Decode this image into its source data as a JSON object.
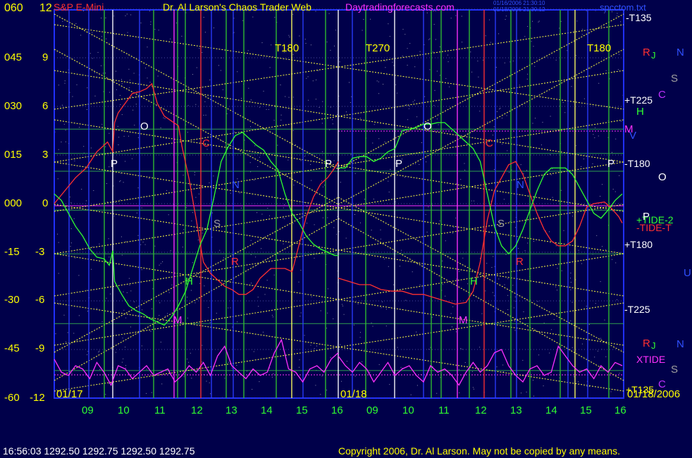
{
  "header": {
    "symbol": "S&P E-Mini",
    "author": "Dr. Al Larson's Chaos Trader Web",
    "website": "Daytradingforecasts.com",
    "info_1": "01/16/2006 21:30:10",
    "info_2": "01/18/2006 21:30:12",
    "file": "spcctom.txt"
  },
  "left_axis": {
    "outer": [
      "060",
      "045",
      "030",
      "015",
      "000",
      "-15",
      "-30",
      "-45",
      "-60"
    ],
    "inner": [
      "12",
      "9",
      "6",
      "3",
      "0",
      "-3",
      "-6",
      "-9",
      "-12"
    ]
  },
  "dates": {
    "day1": "01/17",
    "day2": "01/18",
    "end": "01/18/2006"
  },
  "x_axis": {
    "day1": [
      "09",
      "10",
      "11",
      "12",
      "13",
      "14",
      "15",
      "16"
    ],
    "day2": [
      "09",
      "10",
      "11",
      "12",
      "13",
      "14",
      "15",
      "16"
    ]
  },
  "right_labels": {
    "t135_top": "-T135",
    "t225_plus": "+T225",
    "t180_minus": "-T180",
    "t180_plus": "+T180",
    "t225_minus": "-T225",
    "t135_bottom": "+T135",
    "tide2": "+TIDE-2",
    "tidet": "-TIDE-T",
    "xtide": "XTIDE"
  },
  "markers": {
    "t180_a": "T180",
    "t270": "T270",
    "t180_b": "T180"
  },
  "planet_letters": [
    "O",
    "P",
    "N",
    "S",
    "R",
    "J",
    "H",
    "M",
    "C",
    "V",
    "U"
  ],
  "footer": {
    "quote": "16:56:03  1292.50  1292.75  1292.50  1292.75",
    "copyright": "Copyright 2006, Dr. Al Larson. May not be copied by any means."
  },
  "colors": {
    "background": "#00004a",
    "price": "#ff3030",
    "tide": "#30ff30",
    "xtide": "#ff30ff",
    "axis_text": "#ffff00",
    "hour_text": "#30ff30",
    "grid_dots": "#ffffff"
  },
  "chart_data": {
    "type": "line",
    "ylim_outer": [
      -60,
      60
    ],
    "ylim_inner": [
      -12,
      12
    ],
    "xlim": [
      8.0,
      16.0
    ],
    "series": [
      {
        "name": "TIDE-T",
        "color": "#ff3030",
        "day1": {
          "x": [
            8.0,
            8.3,
            8.6,
            8.9,
            9.2,
            9.5,
            9.65,
            9.7,
            9.8,
            10.0,
            10.2,
            10.4,
            10.6,
            10.75,
            10.9,
            11.1,
            11.3,
            11.5,
            11.6,
            11.8,
            12.0,
            12.2,
            12.4,
            12.6,
            12.8,
            13.0,
            13.2,
            13.4,
            13.6,
            13.8,
            14.0,
            14.1,
            14.3,
            14.5,
            14.7,
            14.9,
            15.1,
            15.3,
            15.5,
            15.7,
            15.9,
            16.0
          ],
          "y": [
            0.0,
            0.8,
            1.6,
            2.2,
            3.2,
            3.8,
            3.2,
            5.0,
            5.6,
            6.2,
            6.8,
            6.9,
            7.1,
            7.4,
            6.2,
            5.4,
            5.1,
            4.8,
            3.5,
            1.5,
            -1.0,
            -3.6,
            -4.3,
            -4.7,
            -5.1,
            -5.3,
            -5.6,
            -5.6,
            -5.3,
            -4.6,
            -4.2,
            -4.0,
            -4.0,
            -4.0,
            -4.2,
            -2.5,
            -0.8,
            0.4,
            1.2,
            1.6,
            2.2,
            2.6
          ]
        },
        "day2": {
          "x": [
            8.0,
            8.3,
            8.6,
            8.9,
            9.2,
            9.5,
            9.8,
            10.1,
            10.4,
            10.7,
            11.0,
            11.3,
            11.6,
            11.8,
            12.0,
            12.2,
            12.4,
            12.6,
            12.8,
            13.0,
            13.2,
            13.4,
            13.6,
            13.8,
            14.0,
            14.2,
            14.4,
            14.6,
            14.8,
            15.0,
            15.2,
            15.5,
            15.7,
            15.9,
            16.0
          ],
          "y": [
            -4.6,
            -4.8,
            -5.0,
            -5.0,
            -5.3,
            -5.4,
            -5.4,
            -5.6,
            -5.6,
            -5.8,
            -6.0,
            -6.2,
            -6.1,
            -5.4,
            -3.6,
            -1.0,
            0.8,
            1.6,
            2.4,
            2.6,
            1.8,
            0.6,
            -0.6,
            -1.6,
            -2.3,
            -2.6,
            -2.6,
            -2.3,
            -1.4,
            -0.2,
            0.0,
            0.1,
            -0.3,
            -0.8,
            -1.2
          ]
        }
      },
      {
        "name": "TIDE-2",
        "color": "#30ff30",
        "day1": {
          "x": [
            8.0,
            8.2,
            8.4,
            8.6,
            8.8,
            9.0,
            9.2,
            9.4,
            9.55,
            9.65,
            9.7,
            9.9,
            10.1,
            10.3,
            10.5,
            10.7,
            10.9,
            11.1,
            11.3,
            11.5,
            11.7,
            11.9,
            12.1,
            12.3,
            12.5,
            12.7,
            12.9,
            13.1,
            13.3,
            13.5,
            13.7,
            13.9,
            14.1,
            14.3,
            14.5,
            14.7,
            14.9,
            15.1,
            15.3,
            15.5,
            15.7,
            15.9,
            16.0
          ],
          "y": [
            0.6,
            0.2,
            -0.6,
            -1.4,
            -2.0,
            -2.8,
            -3.3,
            -3.4,
            -3.8,
            -2.9,
            -4.8,
            -5.6,
            -6.3,
            -6.6,
            -6.8,
            -7.1,
            -7.3,
            -7.5,
            -7.0,
            -6.3,
            -5.4,
            -4.0,
            -2.6,
            -1.6,
            0.4,
            2.6,
            3.5,
            4.2,
            4.4,
            4.0,
            3.6,
            3.3,
            2.6,
            2.1,
            0.6,
            -0.6,
            -1.2,
            -2.0,
            -2.5,
            -2.8,
            -3.0,
            -3.2,
            -3.2
          ]
        },
        "day2": {
          "x": [
            8.0,
            8.2,
            8.4,
            8.6,
            8.8,
            9.0,
            9.2,
            9.4,
            9.6,
            9.8,
            10.0,
            10.2,
            10.4,
            10.6,
            10.8,
            11.0,
            11.2,
            11.4,
            11.6,
            11.8,
            12.0,
            12.2,
            12.4,
            12.6,
            12.8,
            13.0,
            13.2,
            13.4,
            13.6,
            13.8,
            14.0,
            14.2,
            14.4,
            14.6,
            14.8,
            15.0,
            15.2,
            15.4,
            15.6,
            15.8,
            16.0
          ],
          "y": [
            2.2,
            2.2,
            2.8,
            2.9,
            2.9,
            2.6,
            2.8,
            3.2,
            3.4,
            4.5,
            4.6,
            4.7,
            4.9,
            4.9,
            5.0,
            5.0,
            4.6,
            4.2,
            3.8,
            3.4,
            2.6,
            0.6,
            -1.4,
            -2.6,
            -3.1,
            -2.6,
            -1.6,
            -0.4,
            0.8,
            1.8,
            2.2,
            2.2,
            2.2,
            1.8,
            1.0,
            0.2,
            -0.6,
            -0.9,
            -0.4,
            0.2,
            0.6
          ]
        }
      },
      {
        "name": "XTIDE",
        "color": "#ff30ff",
        "day1": {
          "x": [
            8.0,
            8.2,
            8.4,
            8.6,
            8.8,
            9.0,
            9.2,
            9.4,
            9.6,
            9.8,
            10.0,
            10.2,
            10.4,
            10.6,
            10.8,
            11.0,
            11.2,
            11.4,
            11.6,
            11.8,
            12.0,
            12.2,
            12.4,
            12.6,
            12.8,
            13.0,
            13.2,
            13.4,
            13.6,
            13.8,
            14.0,
            14.2,
            14.4,
            14.6,
            14.8,
            15.0,
            15.2,
            15.4,
            15.6,
            15.8,
            16.0
          ],
          "y": [
            -48,
            -52,
            -53,
            -50,
            -51,
            -54,
            -49,
            -52,
            -56,
            -50,
            -51,
            -54,
            -52,
            -50,
            -53,
            -52,
            -51,
            -55,
            -53,
            -50,
            -52,
            -49,
            -53,
            -47,
            -44,
            -50,
            -52,
            -54,
            -51,
            -53,
            -52,
            -46,
            -42,
            -51,
            -52,
            -55,
            -51,
            -50,
            -52,
            -48,
            -46
          ]
        },
        "day2": {
          "x": [
            8.0,
            8.2,
            8.4,
            8.6,
            8.8,
            9.0,
            9.2,
            9.4,
            9.6,
            9.8,
            10.0,
            10.2,
            10.4,
            10.6,
            10.8,
            11.0,
            11.2,
            11.4,
            11.6,
            11.8,
            12.0,
            12.2,
            12.4,
            12.6,
            12.8,
            13.0,
            13.2,
            13.4,
            13.6,
            13.8,
            14.0,
            14.2,
            14.4,
            14.6,
            14.8,
            15.0,
            15.2,
            15.4,
            15.6,
            15.8,
            16.0
          ],
          "y": [
            -47,
            -50,
            -52,
            -49,
            -51,
            -55,
            -52,
            -49,
            -53,
            -51,
            -50,
            -53,
            -55,
            -50,
            -52,
            -51,
            -53,
            -56,
            -52,
            -49,
            -52,
            -50,
            -46,
            -45,
            -50,
            -53,
            -55,
            -51,
            -50,
            -53,
            -52,
            -44,
            -47,
            -50,
            -52,
            -51,
            -54,
            -50,
            -52,
            -49,
            -50
          ]
        }
      }
    ],
    "horizontal_levels": [
      4.6,
      3.1,
      2.0,
      -0.4,
      -3.1,
      -7.4,
      -10.3
    ]
  }
}
